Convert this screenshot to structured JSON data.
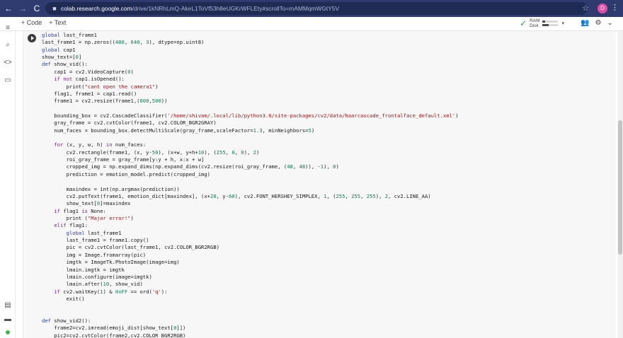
{
  "browser": {
    "back": "←",
    "forward": "→",
    "reload": "C",
    "url_host": "colab.research.google.com",
    "url_path": "/drive/1kNRhLmQ-AkeL1ToVf53h8eUGKrWFLEty#scrollTo=mAMMqmWGtY5V",
    "profile_initial": "D",
    "star": "☆",
    "menu": "⋮"
  },
  "toolbar": {
    "code_label": "+ Code",
    "text_label": "+ Text",
    "ram_label": "RAM",
    "disk_label": "Disk",
    "ram_fraction": 0.2,
    "disk_fraction": 0.45,
    "dropdown": "▾",
    "collapse": "⌄"
  },
  "rail": {
    "menu_icon": "≡",
    "search_icon": "⌕",
    "code_icon": "<>",
    "files_icon": "▭",
    "snippets_icon": "▤",
    "terminal_icon": "▬"
  },
  "code_lines": [
    [
      [
        "kw",
        "global"
      ],
      [
        "",
        " last_frame1"
      ]
    ],
    [
      [
        "",
        "last_frame1 = np.zeros(("
      ],
      [
        "num",
        "480"
      ],
      [
        "",
        ", "
      ],
      [
        "num",
        "640"
      ],
      [
        "",
        ", "
      ],
      [
        "num",
        "3"
      ],
      [
        "",
        "), dtype=np.uint8)"
      ]
    ],
    [
      [
        "kw",
        "global"
      ],
      [
        "",
        " cap1"
      ]
    ],
    [
      [
        "",
        "show_text=["
      ],
      [
        "num",
        "0"
      ],
      [
        "",
        "]"
      ]
    ],
    [
      [
        "kw",
        "def"
      ],
      [
        "",
        " show_vid():"
      ]
    ],
    [
      [
        "",
        "    cap1 = cv2.VideoCapture("
      ],
      [
        "num",
        "0"
      ],
      [
        "",
        ")"
      ]
    ],
    [
      [
        "",
        "    "
      ],
      [
        "cond",
        "if not"
      ],
      [
        "",
        " cap1.isOpened():"
      ]
    ],
    [
      [
        "",
        "        print("
      ],
      [
        "str",
        "\"cant open the camera1\""
      ],
      [
        "",
        ")"
      ]
    ],
    [
      [
        "",
        "    flag1, frame1 = cap1.read()"
      ]
    ],
    [
      [
        "",
        "    frame1 = cv2.resize(frame1,("
      ],
      [
        "num",
        "600"
      ],
      [
        "",
        ","
      ],
      [
        "num",
        "500"
      ],
      [
        "",
        "))"
      ]
    ],
    [
      [
        "",
        ""
      ]
    ],
    [
      [
        "",
        "    bounding_box = cv2.CascadeClassifier("
      ],
      [
        "str",
        "'/home/shivam/.local/lib/python3.6/site-packages/cv2/data/haarcascade_frontalface_default.xml'"
      ],
      [
        "",
        ")"
      ]
    ],
    [
      [
        "",
        "    gray_frame = cv2.cvtColor(frame1, cv2.COLOR_BGR2GRAY)"
      ]
    ],
    [
      [
        "",
        "    num_faces = bounding_box.detectMultiScale(gray_frame,scaleFactor="
      ],
      [
        "num",
        "1.3"
      ],
      [
        "",
        ", minNeighbors="
      ],
      [
        "num",
        "5"
      ],
      [
        "",
        ")"
      ]
    ],
    [
      [
        "",
        ""
      ]
    ],
    [
      [
        "",
        "    "
      ],
      [
        "cond",
        "for"
      ],
      [
        "",
        " (x, y, w, h) "
      ],
      [
        "cond",
        "in"
      ],
      [
        "",
        " num_faces:"
      ]
    ],
    [
      [
        "",
        "        cv2.rectangle(frame1, (x, y-"
      ],
      [
        "num",
        "50"
      ],
      [
        "",
        "), (x+w, y+h+"
      ],
      [
        "num",
        "10"
      ],
      [
        "",
        "), ("
      ],
      [
        "num",
        "255"
      ],
      [
        "",
        ", "
      ],
      [
        "num",
        "0"
      ],
      [
        "",
        ", "
      ],
      [
        "num",
        "0"
      ],
      [
        "",
        "), "
      ],
      [
        "num",
        "2"
      ],
      [
        "",
        ")"
      ]
    ],
    [
      [
        "",
        "        roi_gray_frame = gray_frame[y:y + h, x:x + w]"
      ]
    ],
    [
      [
        "",
        "        cropped_img = np.expand_dims(np.expand_dims(cv2.resize(roi_gray_frame, ("
      ],
      [
        "num",
        "48"
      ],
      [
        "",
        ", "
      ],
      [
        "num",
        "48"
      ],
      [
        "",
        ")), -"
      ],
      [
        "num",
        "1"
      ],
      [
        "",
        "), "
      ],
      [
        "num",
        "0"
      ],
      [
        "",
        ")"
      ]
    ],
    [
      [
        "",
        "        prediction = emotion_model.predict(cropped_img)"
      ]
    ],
    [
      [
        "",
        ""
      ]
    ],
    [
      [
        "",
        "        maxindex = int(np.argmax(prediction))"
      ]
    ],
    [
      [
        "",
        "        cv2.putText(frame1, emotion_dict[maxindex], (x+"
      ],
      [
        "num",
        "20"
      ],
      [
        "",
        ", y-"
      ],
      [
        "num",
        "60"
      ],
      [
        "",
        "), cv2.FONT_HERSHEY_SIMPLEX, "
      ],
      [
        "num",
        "1"
      ],
      [
        "",
        ", ("
      ],
      [
        "num",
        "255"
      ],
      [
        "",
        ", "
      ],
      [
        "num",
        "255"
      ],
      [
        "",
        ", "
      ],
      [
        "num",
        "255"
      ],
      [
        "",
        "), "
      ],
      [
        "num",
        "2"
      ],
      [
        "",
        ", cv2.LINE_AA)"
      ]
    ],
    [
      [
        "",
        "        show_text["
      ],
      [
        "num",
        "0"
      ],
      [
        "",
        "]=maxindex"
      ]
    ],
    [
      [
        "",
        "    "
      ],
      [
        "cond",
        "if"
      ],
      [
        "",
        " flag1 "
      ],
      [
        "cond",
        "is"
      ],
      [
        "",
        " None:"
      ]
    ],
    [
      [
        "",
        "        print ("
      ],
      [
        "str",
        "\"Major error!\""
      ],
      [
        "",
        ")"
      ]
    ],
    [
      [
        "",
        "    "
      ],
      [
        "cond",
        "elif"
      ],
      [
        "",
        " flag1:"
      ]
    ],
    [
      [
        "",
        "        "
      ],
      [
        "kw",
        "global"
      ],
      [
        "",
        " last_frame1"
      ]
    ],
    [
      [
        "",
        "        last_frame1 = frame1.copy()"
      ]
    ],
    [
      [
        "",
        "        pic = cv2.cvtColor(last_frame1, cv2.COLOR_BGR2RGB)"
      ]
    ],
    [
      [
        "",
        "        img = Image.fromarray(pic)"
      ]
    ],
    [
      [
        "",
        "        imgtk = ImageTk.PhotoImage(image=img)"
      ]
    ],
    [
      [
        "",
        "        lmain.imgtk = imgtk"
      ]
    ],
    [
      [
        "",
        "        lmain.configure(image=imgtk)"
      ]
    ],
    [
      [
        "",
        "        lmain.after("
      ],
      [
        "num",
        "10"
      ],
      [
        "",
        ", show_vid)"
      ]
    ],
    [
      [
        "",
        "    "
      ],
      [
        "cond",
        "if"
      ],
      [
        "",
        " cv2.waitKey("
      ],
      [
        "num",
        "1"
      ],
      [
        "",
        ") & "
      ],
      [
        "num",
        "0xFF"
      ],
      [
        "",
        " == ord("
      ],
      [
        "str",
        "'q'"
      ],
      [
        "",
        "):"
      ]
    ],
    [
      [
        "",
        "        exit()"
      ]
    ],
    [
      [
        "",
        ""
      ]
    ],
    [
      [
        "",
        ""
      ]
    ],
    [
      [
        "kw",
        "def"
      ],
      [
        "",
        " show_vid2():"
      ]
    ],
    [
      [
        "",
        "    frame2=cv2.imread(emoji_dist[show_text["
      ],
      [
        "num",
        "0"
      ],
      [
        "",
        "]])"
      ]
    ],
    [
      [
        "",
        "    pic2=cv2.cvtColor(frame2,cv2.COLOR_BGR2RGB)"
      ]
    ]
  ]
}
